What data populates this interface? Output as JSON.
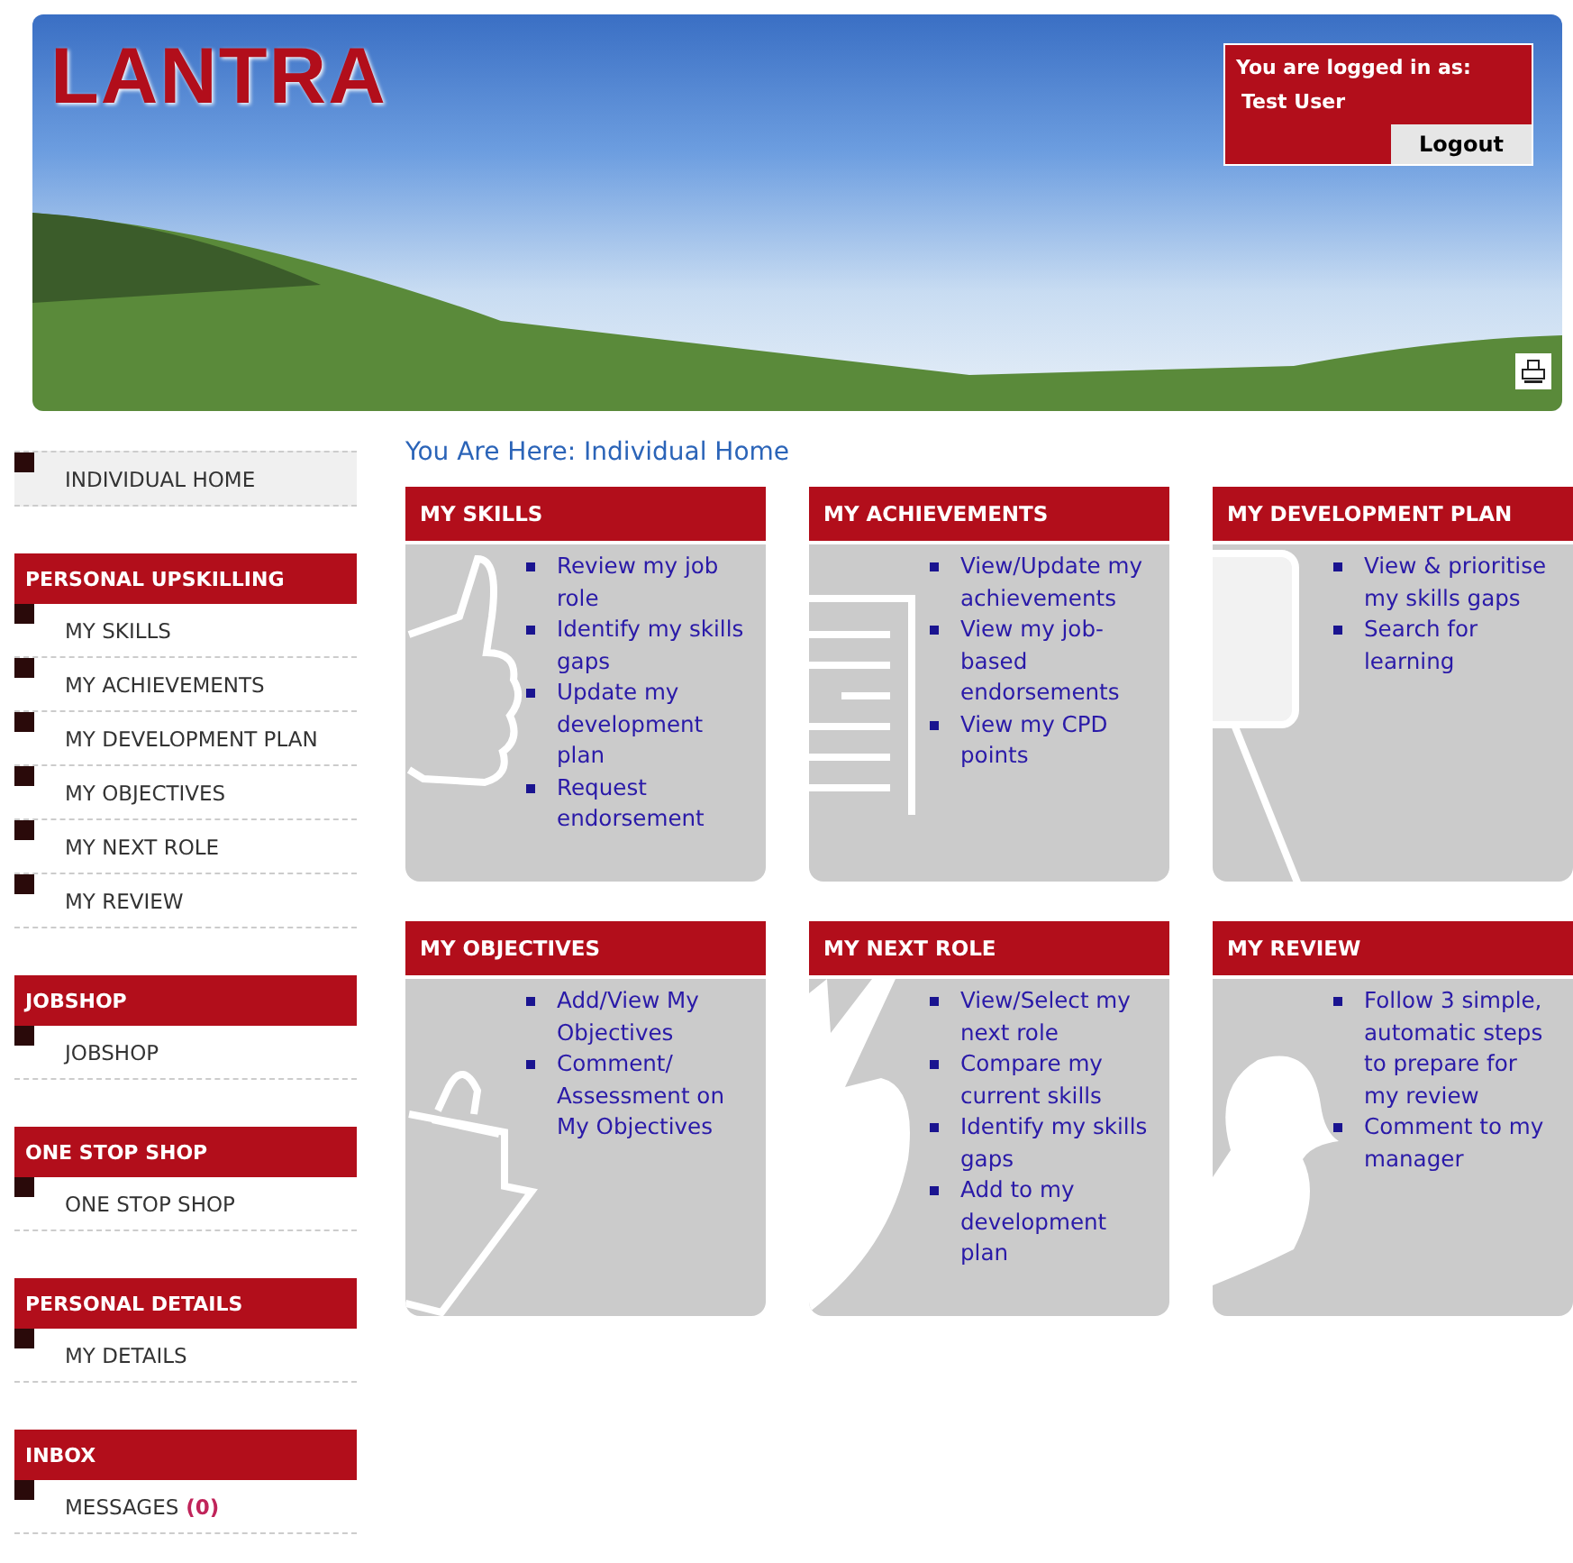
{
  "header": {
    "logo": "LANTRA",
    "login": {
      "caption": "You are logged in as:",
      "user": "Test User",
      "logout": "Logout"
    }
  },
  "sidebar": {
    "home": {
      "label": "INDIVIDUAL HOME",
      "selected": true
    },
    "groups": [
      {
        "title": "PERSONAL UPSKILLING",
        "items": [
          {
            "label": "MY SKILLS",
            "selected": false
          },
          {
            "label": "MY ACHIEVEMENTS",
            "selected": false
          },
          {
            "label": "MY DEVELOPMENT PLAN",
            "selected": false
          },
          {
            "label": "MY OBJECTIVES",
            "selected": false
          },
          {
            "label": "MY NEXT ROLE",
            "selected": false
          },
          {
            "label": "MY REVIEW",
            "selected": false
          }
        ]
      },
      {
        "title": "JOBSHOP",
        "items": [
          {
            "label": "JOBSHOP",
            "selected": false
          }
        ]
      },
      {
        "title": "ONE STOP SHOP",
        "items": [
          {
            "label": "ONE STOP SHOP",
            "selected": false
          }
        ]
      },
      {
        "title": "PERSONAL DETAILS",
        "items": [
          {
            "label": "MY DETAILS",
            "selected": false
          }
        ]
      },
      {
        "title": "INBOX",
        "items": [
          {
            "label": "MESSAGES",
            "count": "(0)",
            "selected": false
          }
        ]
      }
    ]
  },
  "breadcrumb": "You Are Here: Individual Home",
  "cards": [
    {
      "title": "MY SKILLS",
      "kind": "thumb",
      "links": [
        "Review my job role",
        "Identify my skills gaps",
        "Update my development plan",
        "Request endorsement"
      ]
    },
    {
      "title": "MY ACHIEVEMENTS",
      "kind": "document",
      "links": [
        "View/Update my achievements",
        "View my job-based endorsements",
        "View my CPD points"
      ]
    },
    {
      "title": "MY DEVELOPMENT PLAN",
      "kind": "sign",
      "links": [
        "View & prioritise my skills gaps",
        "Search for learning"
      ]
    },
    {
      "title": "MY OBJECTIVES",
      "kind": "clipboard",
      "links": [
        "Add/View My Objectives",
        "Comment/ Assessment on My Objectives"
      ]
    },
    {
      "title": "MY NEXT ROLE",
      "kind": "tick",
      "links": [
        "View/Select my next role",
        "Compare my current skills",
        "Identify my skills gaps",
        "Add to my development plan"
      ]
    },
    {
      "title": "MY REVIEW",
      "kind": "person",
      "links": [
        "Follow 3 simple, automatic steps to prepare for my review",
        "Comment to my manager"
      ]
    }
  ]
}
